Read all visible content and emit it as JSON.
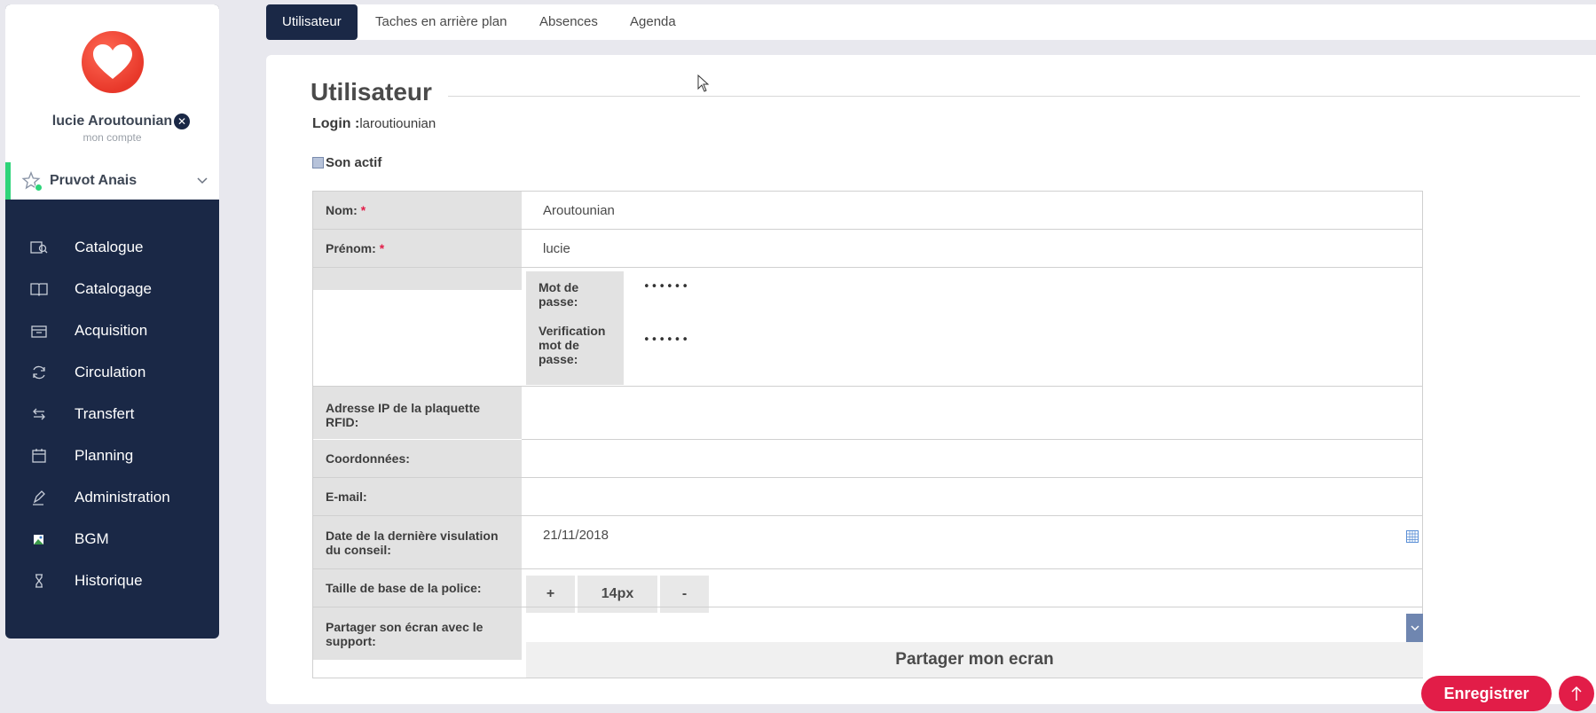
{
  "user": {
    "name": "lucie Aroutounian",
    "subtitle": "mon compte"
  },
  "profile": {
    "name": "Pruvot Anais"
  },
  "nav": [
    {
      "label": "Catalogue",
      "icon": "catalog-search-icon"
    },
    {
      "label": "Catalogage",
      "icon": "open-book-icon"
    },
    {
      "label": "Acquisition",
      "icon": "inbox-icon"
    },
    {
      "label": "Circulation",
      "icon": "refresh-icon"
    },
    {
      "label": "Transfert",
      "icon": "transfer-arrows-icon"
    },
    {
      "label": "Planning",
      "icon": "calendar-icon"
    },
    {
      "label": "Administration",
      "icon": "pen-icon"
    },
    {
      "label": "BGM",
      "icon": "broken-image-icon"
    },
    {
      "label": "Historique",
      "icon": "hourglass-icon"
    }
  ],
  "tabs": [
    "Utilisateur",
    "Taches en arrière plan",
    "Absences",
    "Agenda"
  ],
  "page": {
    "title": "Utilisateur",
    "login_label": "Login :",
    "login_value": "laroutiounian",
    "active_label": "Son actif"
  },
  "form": {
    "nom_label": "Nom:",
    "nom_value": "Aroutounian",
    "prenom_label": "Prénom:",
    "prenom_value": "lucie",
    "required_mark": "*",
    "password_label": "Mot de passe:",
    "password_value": "••••••",
    "password_verify_label": "Verification mot de passe:",
    "password_verify_value": "••••••",
    "rfid_label": "Adresse IP de la plaquette RFID:",
    "rfid_value": "",
    "coords_label": "Coordonnées:",
    "coords_value": "",
    "email_label": "E-mail:",
    "email_value": "",
    "date_label": "Date de la dernière visulation du conseil:",
    "date_value": "21/11/2018",
    "font_label": "Taille de base de la police:",
    "font_plus": "+",
    "font_size": "14px",
    "font_minus": "-",
    "share_label": "Partager son écran avec le support:",
    "share_button": "Partager mon ecran"
  },
  "actions": {
    "save": "Enregistrer"
  },
  "colors": {
    "navy": "#1a2846",
    "accent": "#e21d48",
    "green": "#2ed47a"
  }
}
